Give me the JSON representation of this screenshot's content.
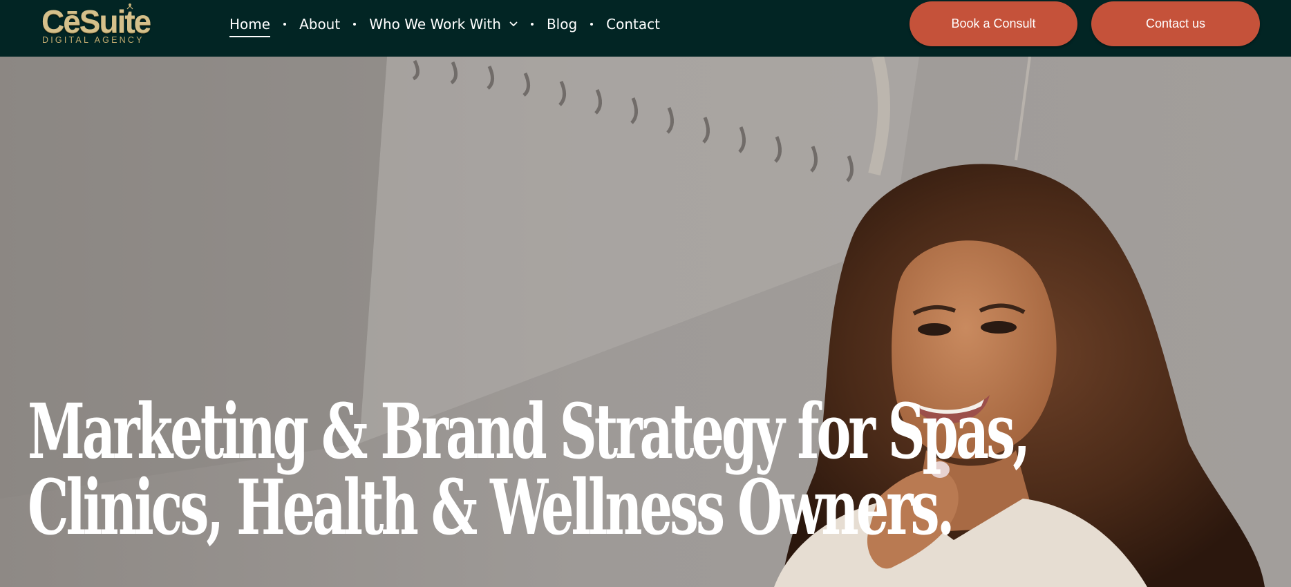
{
  "brand": {
    "name": "CēSuite",
    "tagline": "DIGITAL AGENCY",
    "colors": {
      "nav_bg": "#022524",
      "accent": "#c5523a",
      "logo_gold": "#d5c08b"
    }
  },
  "nav": {
    "items": [
      {
        "label": "Home",
        "active": true
      },
      {
        "label": "About"
      },
      {
        "label": "Who We Work With",
        "icon": "chevron-down-icon"
      },
      {
        "label": "Blog"
      },
      {
        "label": "Contact"
      }
    ]
  },
  "buttons": {
    "book_consult": "Book a Consult",
    "contact_us": "Contact us"
  },
  "hero": {
    "headline_line1": "Marketing & Brand Strategy for Spas,",
    "headline_line2": "Clinics, Health & Wellness Owners."
  }
}
